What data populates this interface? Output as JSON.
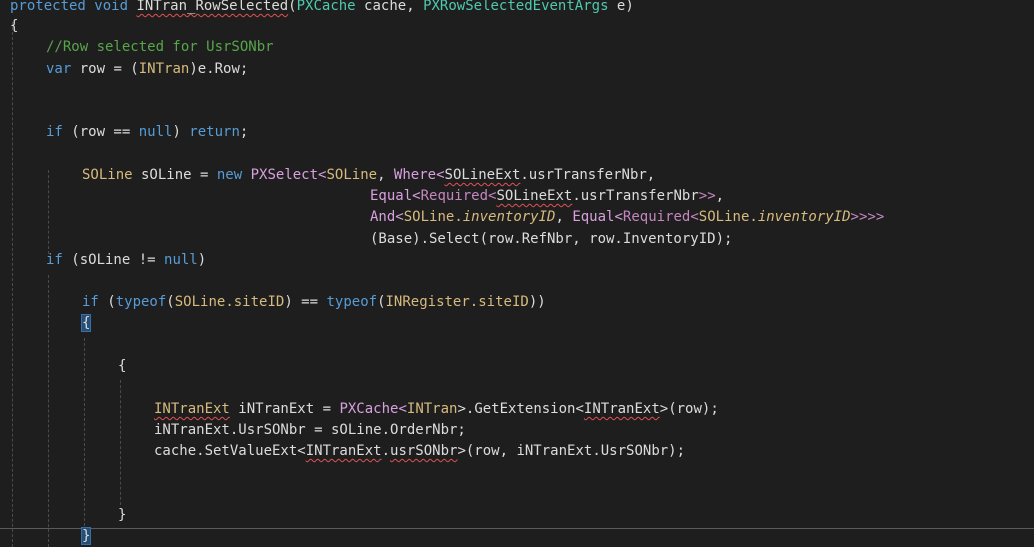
{
  "editor": {
    "lines": [
      {
        "id": "l1",
        "segments": [
          "protected",
          " ",
          "void",
          " ",
          "INTran_RowSelected",
          "(",
          "PXCache",
          " cache, ",
          "PXRowSelectedEventArgs",
          " e)"
        ]
      },
      {
        "id": "l2",
        "segments": [
          "{"
        ]
      },
      {
        "id": "l3",
        "segments": [
          "//Row selected for UsrSONbr"
        ]
      },
      {
        "id": "l4",
        "segments": [
          "var",
          " row = (",
          "INTran",
          ")e.Row;"
        ]
      },
      {
        "id": "l5",
        "segments": [
          "if",
          " (row == ",
          "null",
          ") ",
          "return",
          ";"
        ]
      },
      {
        "id": "l6",
        "segments": [
          "SOLine",
          " sOLine = ",
          "new",
          " ",
          "PXSelect",
          "<",
          "SOLine",
          ", ",
          "Where",
          "<",
          "SOLineExt",
          ".usrTransferNbr,"
        ]
      },
      {
        "id": "l7",
        "segments": [
          "Equal",
          "<",
          "Required",
          "<",
          "SOLineExt",
          ".usrTransferNbr",
          ">>",
          ","
        ]
      },
      {
        "id": "l8",
        "segments": [
          "And",
          "<",
          "SOLine",
          ".",
          "inventoryID",
          ", ",
          "Equal",
          "<",
          "Required",
          "<",
          "SOLine",
          ".",
          "inventoryID",
          ">>>>"
        ]
      },
      {
        "id": "l9",
        "segments": [
          "(Base).Select(row.RefNbr, row.InventoryID);"
        ]
      },
      {
        "id": "l10",
        "segments": [
          "if",
          " (sOLine != ",
          "null",
          ")"
        ]
      },
      {
        "id": "l11",
        "segments": [
          "if",
          " (",
          "typeof",
          "(",
          "SOLine",
          ".",
          "siteID",
          ") == ",
          "typeof",
          "(",
          "INRegister",
          ".",
          "siteID",
          "))"
        ]
      },
      {
        "id": "l12",
        "segments": [
          "{"
        ]
      },
      {
        "id": "l13",
        "segments": [
          "{"
        ]
      },
      {
        "id": "l14",
        "segments": [
          "INTranExt",
          " iNTranExt = ",
          "PXCache",
          "<",
          "INTran",
          ">.GetExtension<",
          "INTranExt",
          ">(row);"
        ]
      },
      {
        "id": "l15",
        "segments": [
          "iNTranExt.UsrSONbr = sOLine.OrderNbr;"
        ]
      },
      {
        "id": "l16",
        "segments": [
          "cache.SetValueExt<",
          "INTranExt",
          ".",
          "usrSONbr",
          ">(row, iNTranExt.UsrSONbr);"
        ]
      },
      {
        "id": "l17",
        "segments": [
          "}"
        ]
      },
      {
        "id": "l18",
        "segments": [
          "}"
        ]
      }
    ]
  },
  "colors": {
    "background": "#1e1e1e",
    "keyword": "#569cd6",
    "type": "#4ec9b0",
    "comment": "#57a64a",
    "method": "#d8a0df",
    "squiggle": "#e05252"
  }
}
